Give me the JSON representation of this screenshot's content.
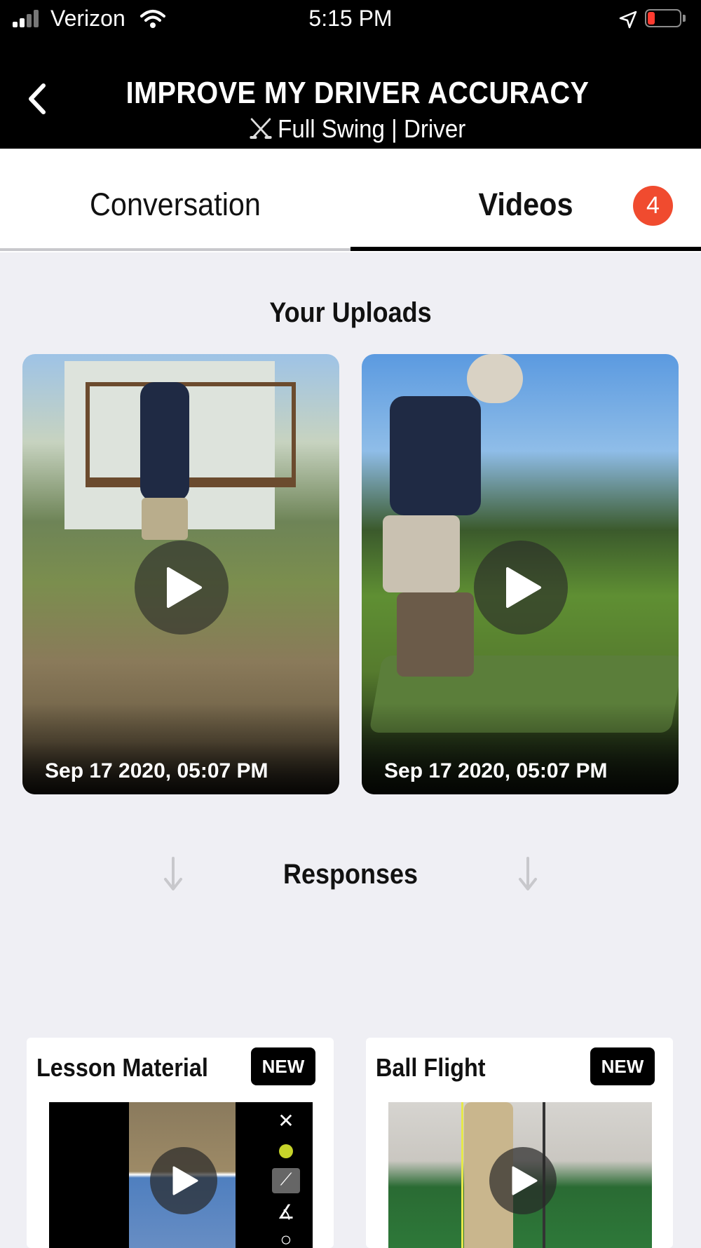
{
  "status_bar": {
    "carrier": "Verizon",
    "time": "5:15 PM",
    "battery_color": "#ff3b30"
  },
  "header": {
    "title": "IMPROVE MY DRIVER ACCURACY",
    "subtitle": "Full Swing | Driver",
    "subtitle_icon": "crossed-clubs-icon",
    "back_icon": "chevron-left-icon"
  },
  "tabs": {
    "conversation_label": "Conversation",
    "videos_label": "Videos",
    "videos_badge": "4",
    "badge_color": "#f04b2f",
    "active": "Videos"
  },
  "uploads": {
    "heading": "Your Uploads",
    "videos": [
      {
        "date": "Sep 17 2020, 05:07 PM"
      },
      {
        "date": "Sep 17 2020, 05:07 PM"
      }
    ]
  },
  "responses": {
    "heading": "Responses",
    "cards": [
      {
        "title": "Lesson Material",
        "badge": "NEW"
      },
      {
        "title": "Ball Flight",
        "badge": "NEW"
      }
    ]
  }
}
